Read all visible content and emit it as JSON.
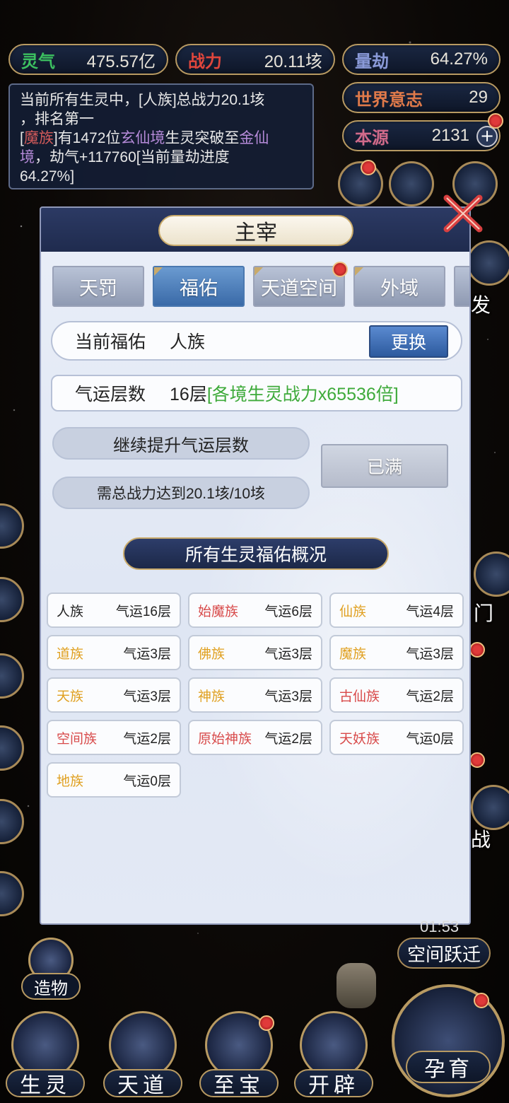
{
  "top_stats": {
    "lingqi": {
      "label": "灵气",
      "value": "475.57亿",
      "color": "#3cc060"
    },
    "zhanli": {
      "label": "战力",
      "value": "20.11垓",
      "color": "#e0463c"
    },
    "liangjie": {
      "label": "量劫",
      "value": "64.27%",
      "color": "#8a9ad8"
    },
    "shijie": {
      "label": "世界意志",
      "value": "29",
      "color": "#e07a4a"
    },
    "benyuan": {
      "label": "本源",
      "value": "2131",
      "color": "#d06a8a"
    }
  },
  "news": {
    "line1": "当前所有生灵中，[人族]总战力20.1垓",
    "line2": "，排名第一",
    "race": "魔族",
    "text_a": "有1472位",
    "realm1": "玄仙境",
    "text_b": "生灵突破至",
    "realm2": "金仙",
    "realm2_tail": "境",
    "text_c": "，劫气+117760[当前量劫进度",
    "text_d": "64.27%]"
  },
  "panel": {
    "title": "主宰",
    "tabs": [
      "天罚",
      "福佑",
      "天道空间",
      "外域"
    ],
    "active_tab": "福佑",
    "current_label": "当前福佑",
    "current_value": "人族",
    "change_btn": "更换",
    "qiyun_label": "气运层数",
    "qiyun_value": "16层",
    "qiyun_bonus": "[各境生灵战力x65536倍]",
    "upgrade_title": "继续提升气运层数",
    "upgrade_req": "需总战力达到20.1垓/10垓",
    "full_btn": "已满",
    "section_title": "所有生灵福佑概况"
  },
  "races": [
    {
      "name": "人族",
      "qiyun": "气运16层",
      "color": "#222222"
    },
    {
      "name": "始魔族",
      "qiyun": "气运6层",
      "color": "#d84a4a"
    },
    {
      "name": "仙族",
      "qiyun": "气运4层",
      "color": "#e0a020"
    },
    {
      "name": "道族",
      "qiyun": "气运3层",
      "color": "#e0a020"
    },
    {
      "name": "佛族",
      "qiyun": "气运3层",
      "color": "#e0a020"
    },
    {
      "name": "魔族",
      "qiyun": "气运3层",
      "color": "#e0a020"
    },
    {
      "name": "天族",
      "qiyun": "气运3层",
      "color": "#e0a020"
    },
    {
      "name": "神族",
      "qiyun": "气运3层",
      "color": "#e0a020"
    },
    {
      "name": "古仙族",
      "qiyun": "气运2层",
      "color": "#d84a4a"
    },
    {
      "name": "空间族",
      "qiyun": "气运2层",
      "color": "#d84a4a"
    },
    {
      "name": "原始神族",
      "qiyun": "气运2层",
      "color": "#d84a4a"
    },
    {
      "name": "天妖族",
      "qiyun": "气运0层",
      "color": "#d84a4a"
    },
    {
      "name": "地族",
      "qiyun": "气运0层",
      "color": "#e0a020"
    }
  ],
  "side": {
    "fa": "发",
    "men": "门",
    "zhan": "战",
    "timer": "01:53",
    "space_jump": "空间跃迁",
    "zaowu": "造物"
  },
  "bottom_nav": [
    "生灵",
    "天道",
    "至宝",
    "开辟"
  ],
  "big_button": "孕育"
}
